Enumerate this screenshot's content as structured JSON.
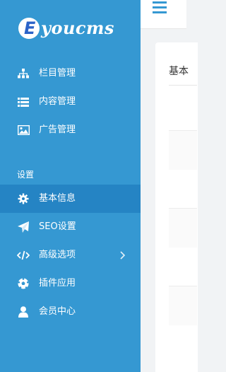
{
  "brand": {
    "logo_text": "youcms"
  },
  "sidebar": {
    "items_top": [
      {
        "label": "栏目管理",
        "icon": "sitemap-icon"
      },
      {
        "label": "内容管理",
        "icon": "list-icon"
      },
      {
        "label": "广告管理",
        "icon": "image-icon"
      }
    ],
    "section_label": "设置",
    "items_settings": [
      {
        "label": "基本信息",
        "icon": "gear-icon",
        "active": true
      },
      {
        "label": "SEO设置",
        "icon": "send-icon"
      },
      {
        "label": "高级选项",
        "icon": "code-icon",
        "has_submenu": true
      },
      {
        "label": "插件应用",
        "icon": "soccer-ball-icon"
      },
      {
        "label": "会员中心",
        "icon": "user-icon"
      }
    ]
  },
  "header": {
    "menu_icon": "hamburger-icon"
  },
  "content": {
    "title": "基本"
  },
  "colors": {
    "sidebar_bg": "#3598d2",
    "sidebar_active": "#2584c4",
    "accent": "#3598d2"
  }
}
